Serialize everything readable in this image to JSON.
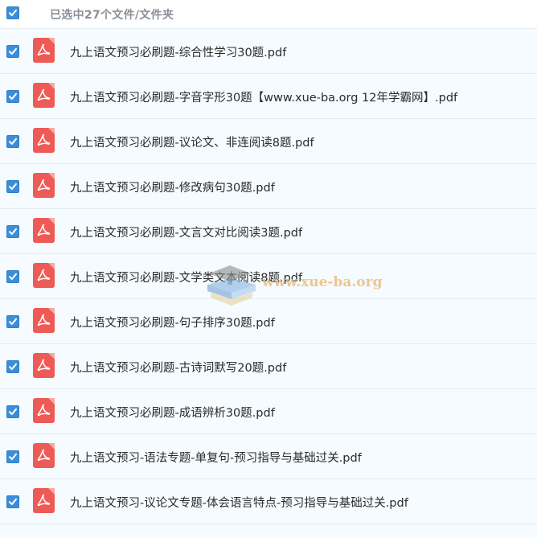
{
  "header": {
    "summary": "已选中27个文件/文件夹",
    "select_all_checked": true
  },
  "files": [
    {
      "name": "九上语文预习必刷题-综合性学习30题.pdf",
      "type": "pdf",
      "checked": true
    },
    {
      "name": "九上语文预习必刷题-字音字形30题【www.xue-ba.org 12年学霸网】.pdf",
      "type": "pdf",
      "checked": true
    },
    {
      "name": "九上语文预习必刷题-议论文、非连阅读8题.pdf",
      "type": "pdf",
      "checked": true
    },
    {
      "name": "九上语文预习必刷题-修改病句30题.pdf",
      "type": "pdf",
      "checked": true
    },
    {
      "name": "九上语文预习必刷题-文言文对比阅读3题.pdf",
      "type": "pdf",
      "checked": true
    },
    {
      "name": "九上语文预习必刷题-文学类文本阅读8题.pdf",
      "type": "pdf",
      "checked": true
    },
    {
      "name": "九上语文预习必刷题-句子排序30题.pdf",
      "type": "pdf",
      "checked": true
    },
    {
      "name": "九上语文预习必刷题-古诗词默写20题.pdf",
      "type": "pdf",
      "checked": true
    },
    {
      "name": "九上语文预习必刷题-成语辨析30题.pdf",
      "type": "pdf",
      "checked": true
    },
    {
      "name": "九上语文预习-语法专题-单复句-预习指导与基础过关.pdf",
      "type": "pdf",
      "checked": true
    },
    {
      "name": "九上语文预习-议论文专题-体会语言特点-预习指导与基础过关.pdf",
      "type": "pdf",
      "checked": true
    }
  ],
  "watermark": {
    "text": "www.xue-ba.org"
  },
  "colors": {
    "checkbox": "#3b8fd9",
    "pdf_icon": "#ee5a55",
    "row_bg": "#f5fbff",
    "header_text": "#8a8f96"
  }
}
